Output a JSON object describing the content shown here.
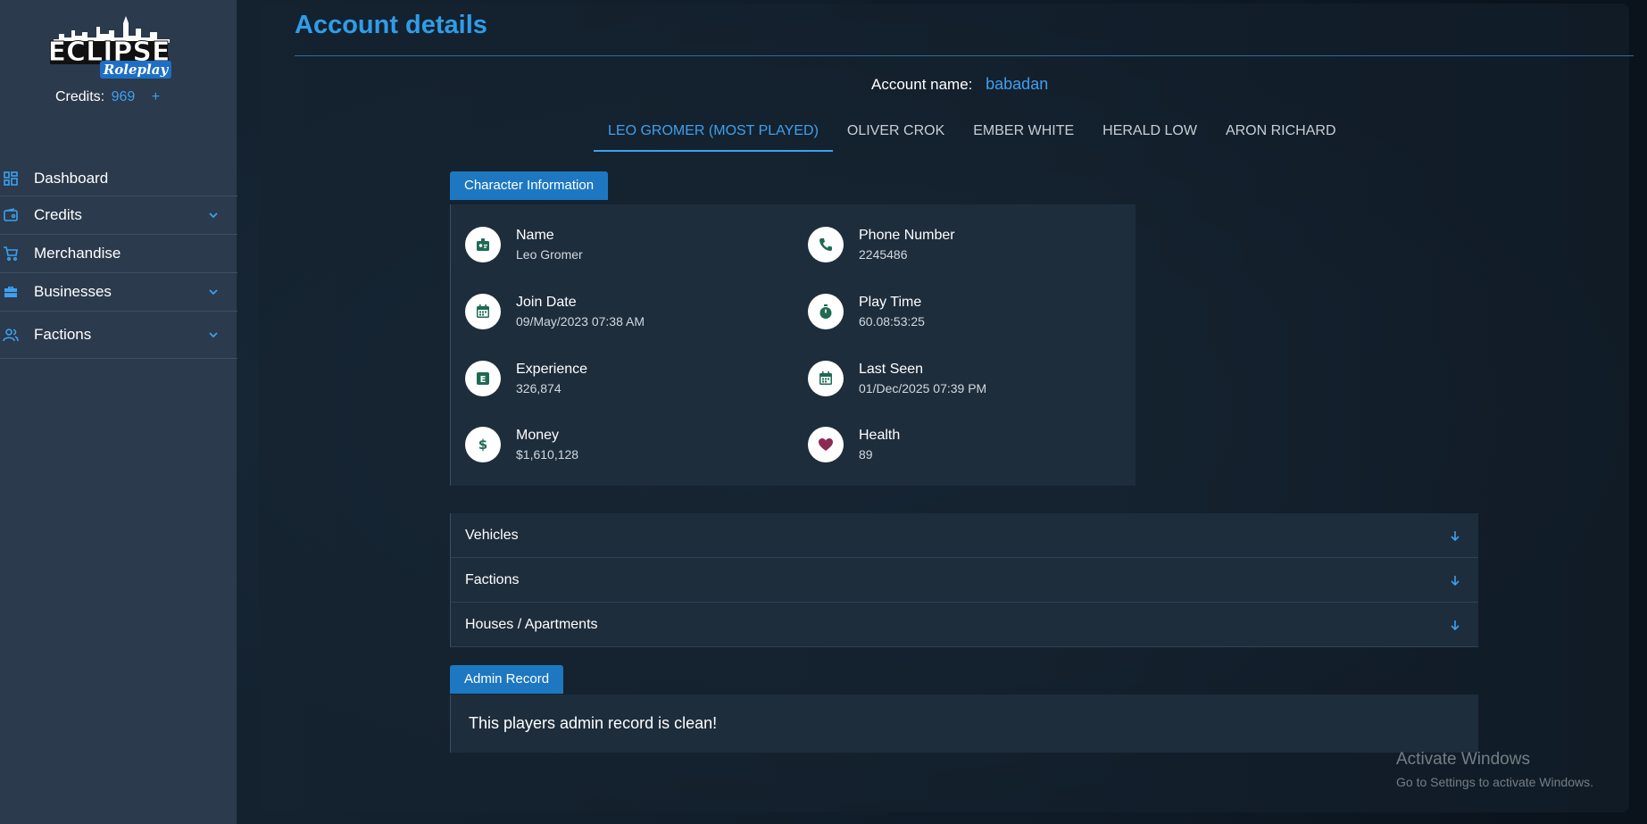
{
  "sidebar": {
    "credits_label": "Credits:",
    "credits_value": "969",
    "credits_plus": "+",
    "items": [
      {
        "label": "Dashboard"
      },
      {
        "label": "Credits"
      },
      {
        "label": "Merchandise"
      },
      {
        "label": "Businesses"
      },
      {
        "label": "Factions"
      }
    ]
  },
  "main": {
    "title": "Account details",
    "account_label": "Account name:",
    "account_value": "babadan",
    "tabs": [
      {
        "label": "LEO GROMER (MOST PLAYED)"
      },
      {
        "label": "OLIVER CROK"
      },
      {
        "label": "EMBER WHITE"
      },
      {
        "label": "HERALD LOW"
      },
      {
        "label": "ARON RICHARD"
      }
    ],
    "character_badge": "Character Information",
    "fields": {
      "name": {
        "label": "Name",
        "value": "Leo Gromer"
      },
      "phone": {
        "label": "Phone Number",
        "value": "2245486"
      },
      "join": {
        "label": "Join Date",
        "value": "09/May/2023 07:38 AM"
      },
      "playtime": {
        "label": "Play Time",
        "value": "60.08:53:25"
      },
      "experience": {
        "label": "Experience",
        "value": "326,874"
      },
      "lastseen": {
        "label": "Last Seen",
        "value": "01/Dec/2025 07:39 PM"
      },
      "money": {
        "label": "Money",
        "value": "$1,610,128"
      },
      "health": {
        "label": "Health",
        "value": "89"
      }
    },
    "accordions": [
      {
        "label": "Vehicles"
      },
      {
        "label": "Factions"
      },
      {
        "label": "Houses / Apartments"
      }
    ],
    "admin_badge": "Admin Record",
    "admin_message": "This players admin record is clean!"
  },
  "watermark": {
    "line1": "Activate Windows",
    "line2": "Go to Settings to activate Windows."
  },
  "colors": {
    "accent": "#3ea0f0",
    "badge": "#1d78c1",
    "sidebar": "#2b3a4c",
    "icon_green": "#1e6b52",
    "heart": "#8b2a52"
  }
}
